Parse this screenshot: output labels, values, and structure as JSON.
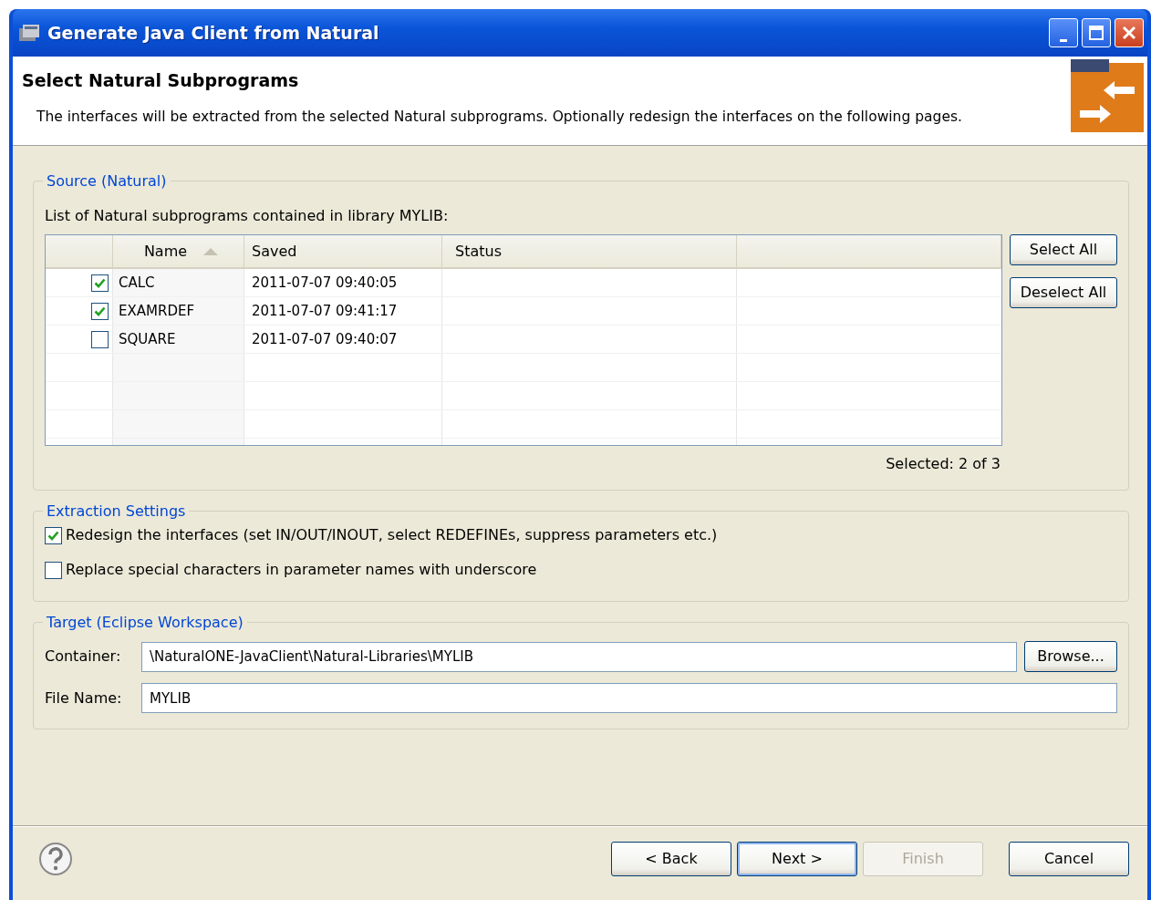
{
  "window": {
    "title": "Generate Java Client from Natural"
  },
  "header": {
    "title": "Select Natural Subprograms",
    "description": "The interfaces will be extracted from the selected Natural subprograms. Optionally redesign the interfaces on the following pages."
  },
  "source_group": {
    "legend": "Source (Natural)",
    "list_label": "List of Natural subprograms contained in library MYLIB:",
    "table": {
      "columns": [
        {
          "label": "Name",
          "sorted": true
        },
        {
          "label": "Saved",
          "sorted": false
        },
        {
          "label": "Status",
          "sorted": false
        }
      ],
      "rows": [
        {
          "checked": true,
          "name": "CALC",
          "saved": "2011-07-07 09:40:05"
        },
        {
          "checked": true,
          "name": "EXAMRDEF",
          "saved": "2011-07-07 09:41:17"
        },
        {
          "checked": false,
          "name": "SQUARE",
          "saved": "2011-07-07 09:40:07"
        }
      ]
    },
    "buttons": [
      "Select All",
      "Deselect All"
    ],
    "selection_count": "Selected: 2 of 3"
  },
  "extraction_group": {
    "legend": "Extraction Settings",
    "options": [
      {
        "label": "Redesign the interfaces (set IN/OUT/INOUT, select REDEFINEs, suppress parameters etc.)",
        "checked": true
      },
      {
        "label": "Replace special characters in parameter names with underscore",
        "checked": false
      }
    ]
  },
  "target_group": {
    "legend": "Target (Eclipse Workspace)",
    "fields": [
      {
        "label": "Container:",
        "value": "\\NaturalONE-JavaClient\\Natural-Libraries\\MYLIB",
        "button": "Browse..."
      },
      {
        "label": "File Name:",
        "value": "MYLIB"
      }
    ]
  },
  "footer_buttons": [
    {
      "label": "< Back",
      "disabled": false,
      "default": false
    },
    {
      "label": "Next >",
      "disabled": false,
      "default": true
    },
    {
      "label": "Finish",
      "disabled": true,
      "default": false
    },
    {
      "label": "Cancel",
      "disabled": false,
      "default": false
    }
  ]
}
